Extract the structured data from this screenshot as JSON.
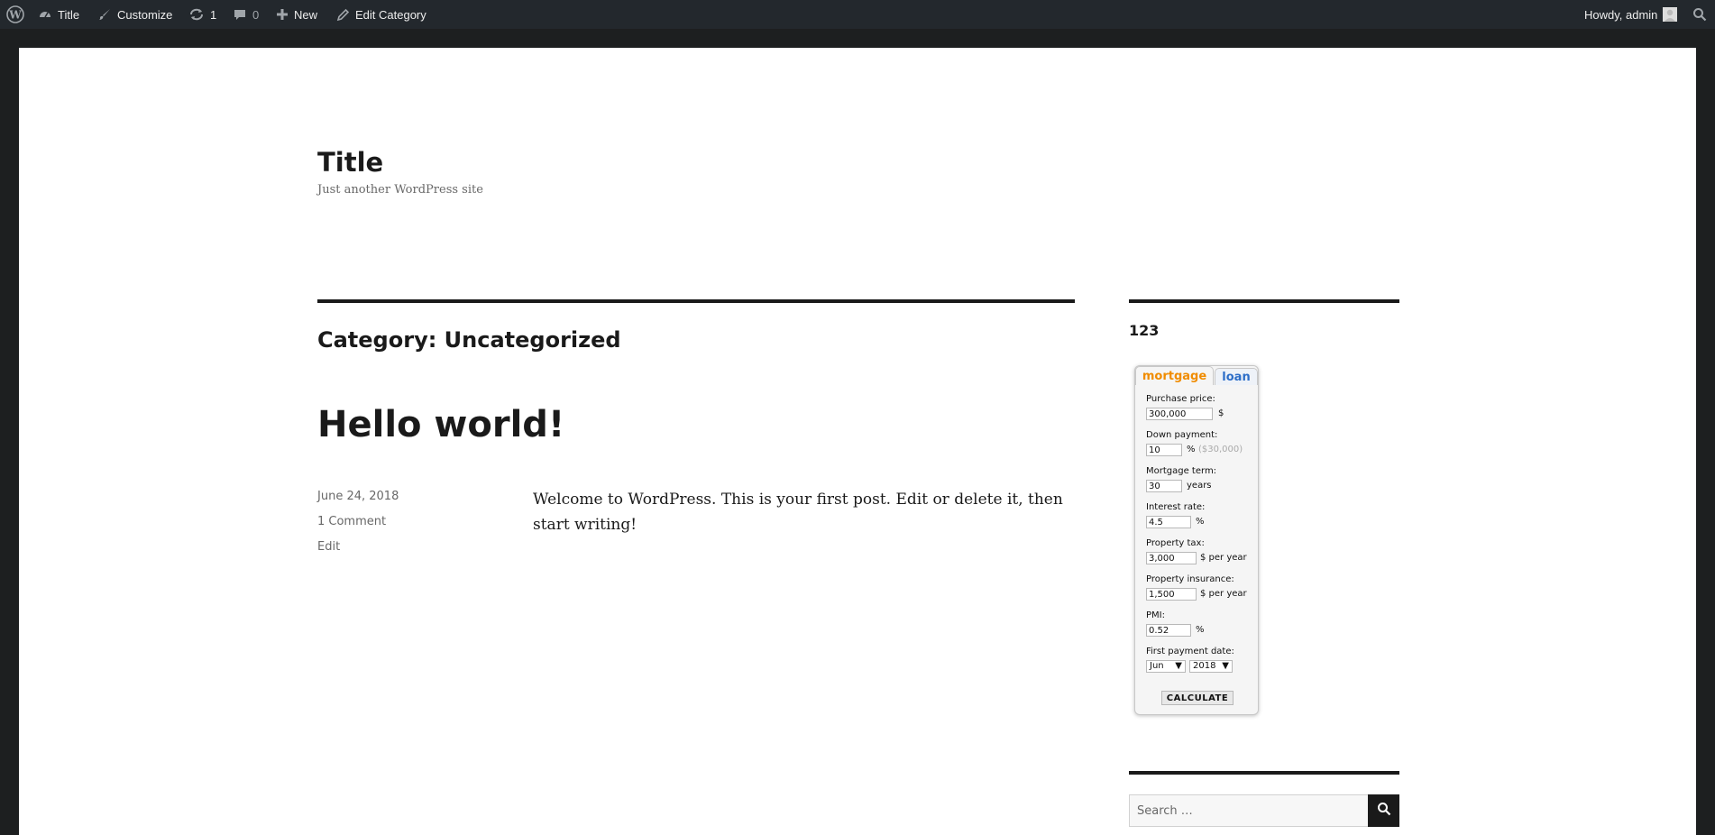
{
  "admin_bar": {
    "site_name": "Title",
    "customize": "Customize",
    "updates_count": "1",
    "comments_count": "0",
    "new": "New",
    "edit_category": "Edit Category",
    "howdy": "Howdy, admin"
  },
  "header": {
    "site_title": "Title",
    "tagline": "Just another WordPress site"
  },
  "main": {
    "archive_title": "Category: Uncategorized",
    "post": {
      "title": "Hello world!",
      "date": "June 24, 2018",
      "comments": "1 Comment",
      "edit": "Edit",
      "content": "Welcome to WordPress. This is your first post. Edit or delete it, then start writing!"
    }
  },
  "sidebar": {
    "widget_title": "123",
    "calculator": {
      "tabs": [
        "mortgage",
        "loan"
      ],
      "purchase_price_label": "Purchase price:",
      "purchase_price": "300,000",
      "purchase_price_unit": "$",
      "down_payment_label": "Down payment:",
      "down_payment": "10",
      "down_payment_unit": "%",
      "down_payment_amount": "($30,000)",
      "term_label": "Mortgage term:",
      "term": "30",
      "term_unit": "years",
      "rate_label": "Interest rate:",
      "rate": "4.5",
      "rate_unit": "%",
      "tax_label": "Property tax:",
      "tax": "3,000",
      "tax_unit": "$ per year",
      "insurance_label": "Property insurance:",
      "insurance": "1,500",
      "insurance_unit": "$ per year",
      "pmi_label": "PMI:",
      "pmi": "0.52",
      "pmi_unit": "%",
      "first_payment_label": "First payment date:",
      "first_payment_month": "Jun",
      "first_payment_year": "2018",
      "calculate_label": "CALCULATE"
    },
    "search_placeholder": "Search …"
  },
  "colors": {
    "admin_bar_bg": "#23282d",
    "page_frame": "#1d1f20",
    "tab_mortgage": "#f08c00",
    "tab_loan": "#2d6ec8"
  }
}
